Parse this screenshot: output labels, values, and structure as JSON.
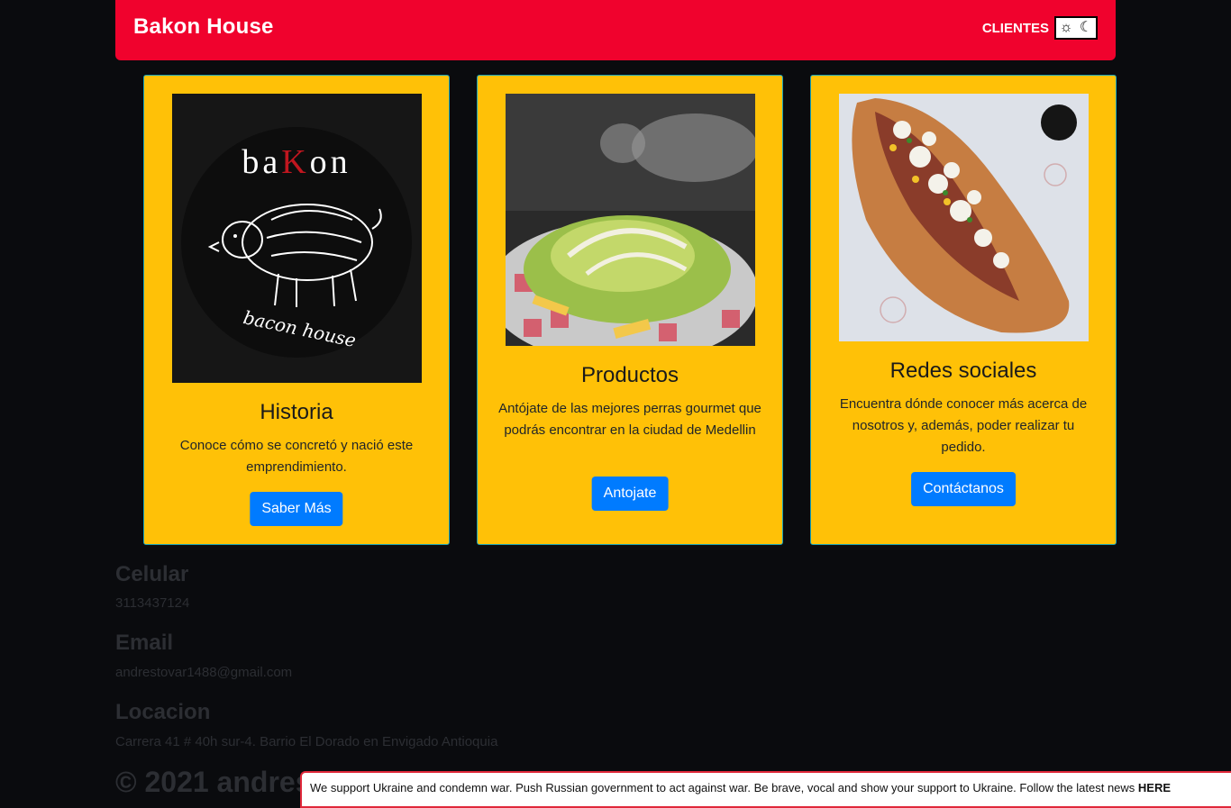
{
  "navbar": {
    "brand": "Bakon House",
    "link": "CLIENTES",
    "toggle_icons": [
      "sun-icon",
      "moon-icon"
    ]
  },
  "cards": [
    {
      "title": "Historia",
      "text": "Conoce cómo se concretó y nació este emprendimiento.",
      "button": "Saber Más",
      "image": "bakon-logo-image"
    },
    {
      "title": "Productos",
      "text": "Antójate de las mejores perras gourmet que podrás encontrar en la ciudad de Medellin",
      "button": "Antojate",
      "image": "loaded-fries-image"
    },
    {
      "title": "Redes sociales",
      "text": "Encuentra dónde conocer más acerca de nosotros y, además, poder realizar tu pedido.",
      "button": "Contáctanos",
      "image": "hotdog-image"
    }
  ],
  "footer": {
    "phone_label": "Celular",
    "phone": "3113437124",
    "email_label": "Email",
    "email": "andrestovar1488@gmail.com",
    "location_label": "Locacion",
    "location": "Carrera 41 # 40h sur-4. Barrio El Dorado en Envigado Antioquia",
    "copyright": "© 2021 andres"
  },
  "banner": {
    "text": "We support Ukraine and condemn war. Push Russian government to act against war. Be brave, vocal and show your support to Ukraine. Follow the latest news ",
    "link": "HERE"
  },
  "logo_text": {
    "top": "baKon",
    "bottom": "bacon house"
  },
  "colors": {
    "navbar": "#f0022d",
    "card": "#ffc107",
    "button": "#007bff",
    "background": "#0a0b0e"
  }
}
